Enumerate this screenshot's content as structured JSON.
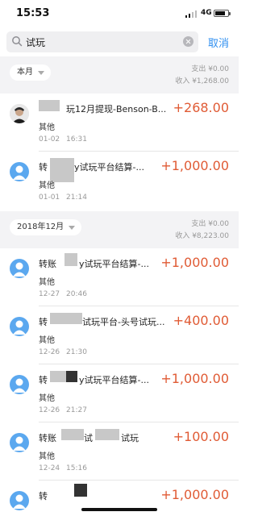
{
  "status": {
    "time": "15:53",
    "network": "4G"
  },
  "search": {
    "query": "试玩",
    "cancel_label": "取消"
  },
  "months": [
    {
      "label": "本月",
      "expense": "支出 ¥0.00",
      "income": "收入 ¥1,268.00"
    },
    {
      "label": "2018年12月",
      "expense": "支出 ¥0.00",
      "income": "收入 ¥8,223.00"
    }
  ],
  "transactions": [
    {
      "title_a": "",
      "title_b": "玩12月提现-Benson-B...",
      "amount": "+268.00",
      "category": "其他",
      "date": "01-02",
      "time": "16:31"
    },
    {
      "title_a": "转",
      "title_b": "y试玩平台结算-...",
      "amount": "+1,000.00",
      "category": "其他",
      "date": "01-01",
      "time": "21:14"
    },
    {
      "title_a": "转账",
      "title_b": "y试玩平台结算-...",
      "amount": "+1,000.00",
      "category": "其他",
      "date": "12-27",
      "time": "20:46"
    },
    {
      "title_a": "转",
      "title_b": "试玩平台-头号试玩...",
      "amount": "+400.00",
      "category": "其他",
      "date": "12-26",
      "time": "21:30"
    },
    {
      "title_a": "转",
      "title_b": "y试玩平台结算-...",
      "amount": "+1,000.00",
      "category": "其他",
      "date": "12-26",
      "time": "21:27"
    },
    {
      "title_a": "转账",
      "title_b": "试",
      "title_c": "试玩",
      "amount": "+100.00",
      "category": "其他",
      "date": "12-24",
      "time": "15:16"
    },
    {
      "title_a": "转",
      "title_b": "",
      "amount": "+1,000.00",
      "category": "",
      "date": "",
      "time": ""
    }
  ]
}
